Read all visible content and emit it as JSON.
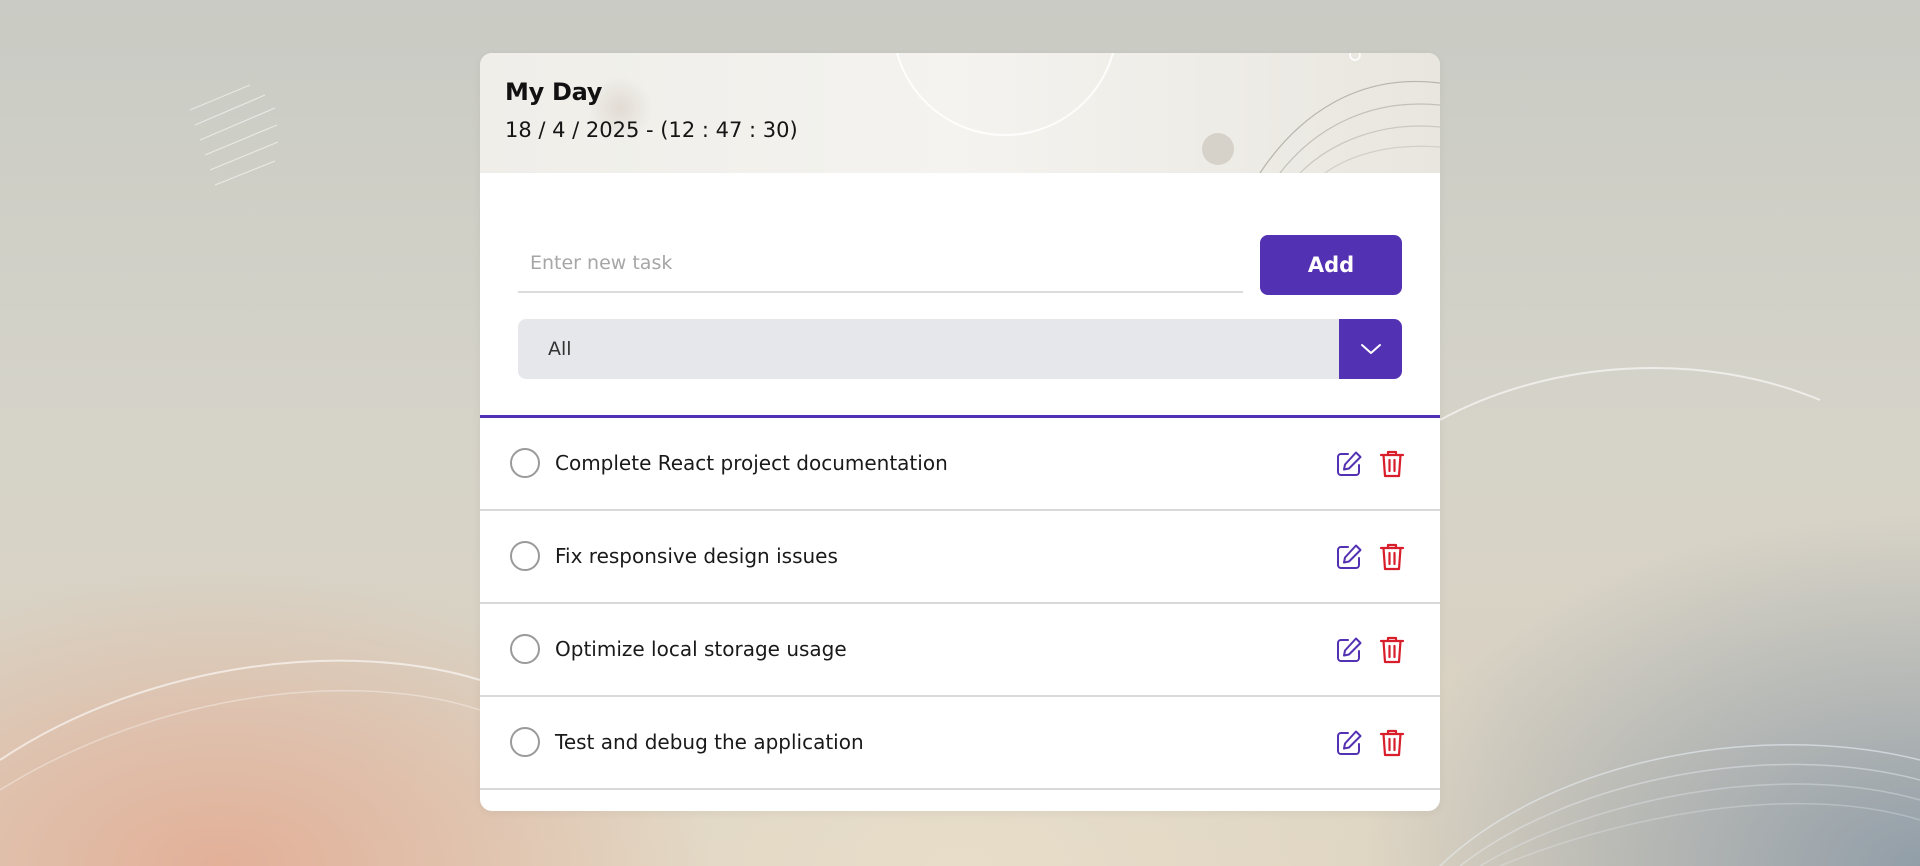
{
  "header": {
    "title": "My Day",
    "datetime": "18 / 4 / 2025 - (12 : 47 : 30)"
  },
  "new_task": {
    "placeholder": "Enter new task",
    "value": "",
    "add_label": "Add"
  },
  "filter": {
    "selected": "All"
  },
  "tasks": [
    {
      "text": "Complete React project documentation",
      "completed": false
    },
    {
      "text": "Fix responsive design issues",
      "completed": false
    },
    {
      "text": "Optimize local storage usage",
      "completed": false
    },
    {
      "text": "Test and debug the application",
      "completed": false
    }
  ],
  "colors": {
    "accent": "#5331b3",
    "delete": "#d91e2b",
    "filter_bg": "#e6e7ea"
  },
  "icons": {
    "edit": "pencil-square-icon",
    "delete": "trash-icon",
    "dropdown": "chevron-down-icon",
    "checkbox": "circle-checkbox-icon"
  }
}
